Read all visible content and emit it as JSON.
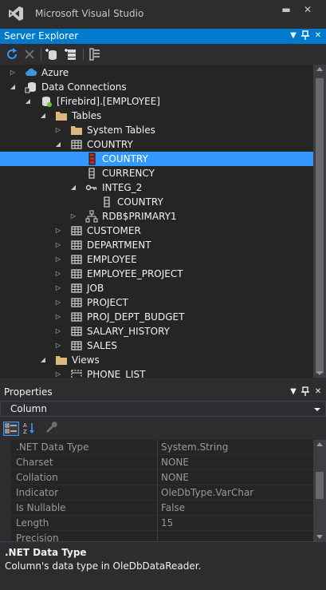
{
  "window": {
    "title": "Microsoft Visual Studio"
  },
  "server_explorer": {
    "title": "Server Explorer",
    "tree": [
      {
        "label": "Azure",
        "icon": "azure-cloud-icon",
        "arrow": "collapsed",
        "level": 0
      },
      {
        "label": "Data Connections",
        "icon": "data-connections-icon",
        "arrow": "expanded",
        "level": 0
      },
      {
        "label": "[Firebird].[EMPLOYEE]",
        "icon": "database-icon",
        "arrow": "expanded",
        "level": 1
      },
      {
        "label": "Tables",
        "icon": "folder-icon",
        "arrow": "expanded",
        "level": 2
      },
      {
        "label": "System Tables",
        "icon": "folder-icon",
        "arrow": "collapsed",
        "level": 3
      },
      {
        "label": "COUNTRY",
        "icon": "table-icon",
        "arrow": "expanded",
        "level": 3
      },
      {
        "label": "COUNTRY",
        "icon": "column-icon",
        "arrow": "none",
        "level": 4,
        "selected": true
      },
      {
        "label": "CURRENCY",
        "icon": "column-icon",
        "arrow": "none",
        "level": 4
      },
      {
        "label": "INTEG_2",
        "icon": "key-icon",
        "arrow": "expanded",
        "level": 4
      },
      {
        "label": "COUNTRY",
        "icon": "column-icon",
        "arrow": "none",
        "level": 5
      },
      {
        "label": "RDB$PRIMARY1",
        "icon": "index-icon",
        "arrow": "collapsed",
        "level": 4
      },
      {
        "label": "CUSTOMER",
        "icon": "table-icon",
        "arrow": "collapsed",
        "level": 3
      },
      {
        "label": "DEPARTMENT",
        "icon": "table-icon",
        "arrow": "collapsed",
        "level": 3
      },
      {
        "label": "EMPLOYEE",
        "icon": "table-icon",
        "arrow": "collapsed",
        "level": 3
      },
      {
        "label": "EMPLOYEE_PROJECT",
        "icon": "table-icon",
        "arrow": "collapsed",
        "level": 3
      },
      {
        "label": "JOB",
        "icon": "table-icon",
        "arrow": "collapsed",
        "level": 3
      },
      {
        "label": "PROJECT",
        "icon": "table-icon",
        "arrow": "collapsed",
        "level": 3
      },
      {
        "label": "PROJ_DEPT_BUDGET",
        "icon": "table-icon",
        "arrow": "collapsed",
        "level": 3
      },
      {
        "label": "SALARY_HISTORY",
        "icon": "table-icon",
        "arrow": "collapsed",
        "level": 3
      },
      {
        "label": "SALES",
        "icon": "table-icon",
        "arrow": "collapsed",
        "level": 3
      },
      {
        "label": "Views",
        "icon": "folder-icon",
        "arrow": "expanded",
        "level": 2
      },
      {
        "label": "PHONE_LIST",
        "icon": "view-icon",
        "arrow": "collapsed",
        "level": 3
      }
    ]
  },
  "properties": {
    "title": "Properties",
    "object": "Column",
    "rows": [
      {
        "name": ".NET Data Type",
        "value": "System.String"
      },
      {
        "name": "Charset",
        "value": "NONE"
      },
      {
        "name": "Collation",
        "value": "NONE"
      },
      {
        "name": "Indicator",
        "value": "OleDbType.VarChar"
      },
      {
        "name": "Is Nullable",
        "value": "False"
      },
      {
        "name": "Length",
        "value": "15"
      },
      {
        "name": "Precision",
        "value": ""
      }
    ],
    "description_title": ".NET Data Type",
    "description_text": "Column's data type in OleDbDataReader."
  },
  "colors": {
    "accent": "#007acc",
    "selection": "#3399ff",
    "background": "#2d2d30",
    "tree_background": "#252526",
    "folder": "#dcb67a"
  }
}
